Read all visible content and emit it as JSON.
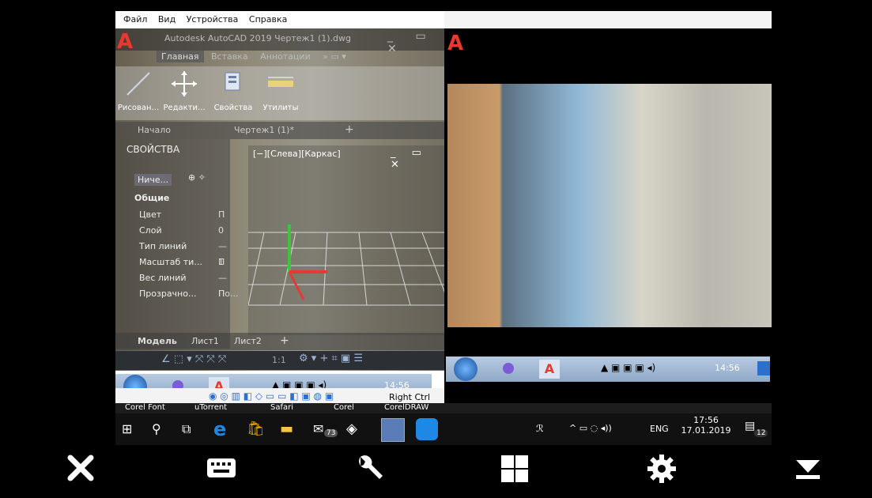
{
  "left_vm": {
    "menu": [
      "Файл",
      "Вид",
      "Устройства",
      "Справка"
    ],
    "app_title": "Autodesk AutoCAD 2019   Чертеж1 (1).dwg",
    "ribbon_tabs": [
      "Главная",
      "Вставка",
      "Аннотации"
    ],
    "ribbon_buttons": [
      "Рисован...",
      "Редакти...",
      "Свойства",
      "Утилиты"
    ],
    "doc_tabs": [
      "Начало",
      "Чертеж1 (1)*"
    ],
    "panel_title": "СВОЙСТВА",
    "dropdown": "Ниче...",
    "props_header": "Общие",
    "props_rows": [
      {
        "label": "Цвет",
        "value": "П"
      },
      {
        "label": "Слой",
        "value": "0"
      },
      {
        "label": "Тип линий",
        "value": "— П"
      },
      {
        "label": "Масштаб ти...",
        "value": "1"
      },
      {
        "label": "Вес линий",
        "value": "— П"
      },
      {
        "label": "Прозрачно...",
        "value": "По..."
      }
    ],
    "viewport_title": "[−][Слева][Каркас]",
    "layout_tabs": [
      "Модель",
      "Лист1",
      "Лист2"
    ],
    "scale_label": "1:1",
    "tray_time": "14:56",
    "host_key": "Right Ctrl"
  },
  "right_vm": {
    "tray_time": "14:56"
  },
  "host_taskbar": {
    "labels": [
      "Corel Font",
      "uTorrent",
      "Safari",
      "Corel",
      "CorelDRAW"
    ],
    "mail_badge": "73",
    "lang": "ENG",
    "time": "17:56",
    "date": "17.01.2019",
    "notif_count": "12"
  },
  "colors": {
    "autocad_red": "#e63a2f",
    "win_blue": "#1e88e5",
    "overlay_icons": "#ffffff"
  }
}
